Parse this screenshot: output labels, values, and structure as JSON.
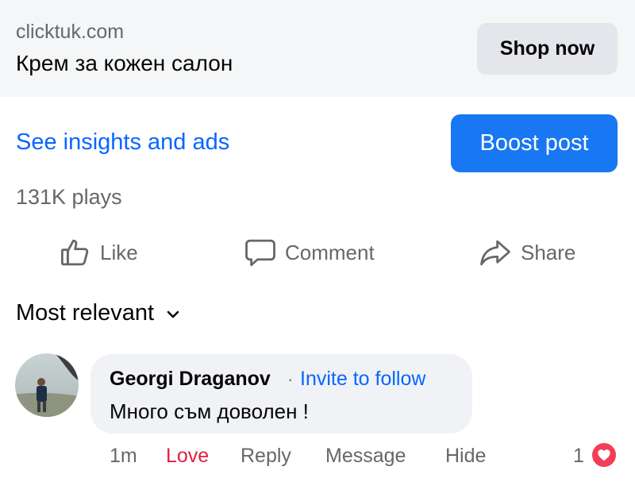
{
  "ad": {
    "domain": "clicktuk.com",
    "title": "Крем за кожен салон",
    "cta": "Shop now"
  },
  "post_tools": {
    "insights_link": "See insights and ads",
    "boost_button": "Boost post",
    "plays": "131K plays"
  },
  "actions": {
    "like": "Like",
    "comment": "Comment",
    "share": "Share"
  },
  "sort": {
    "label": "Most relevant"
  },
  "comment": {
    "author": "Georgi Draganov",
    "separator": "·",
    "follow_link": "Invite to follow",
    "text": "Много съм доволен !",
    "time": "1m",
    "love": "Love",
    "reply": "Reply",
    "message": "Message",
    "hide": "Hide",
    "reaction_count": "1",
    "reaction_icon": "heart-icon"
  },
  "colors": {
    "link_blue": "#0866ff",
    "boost_blue": "#1877f2",
    "love_red": "#e41e3f",
    "heart_badge": "#f33e58",
    "secondary_text": "#65676b"
  }
}
